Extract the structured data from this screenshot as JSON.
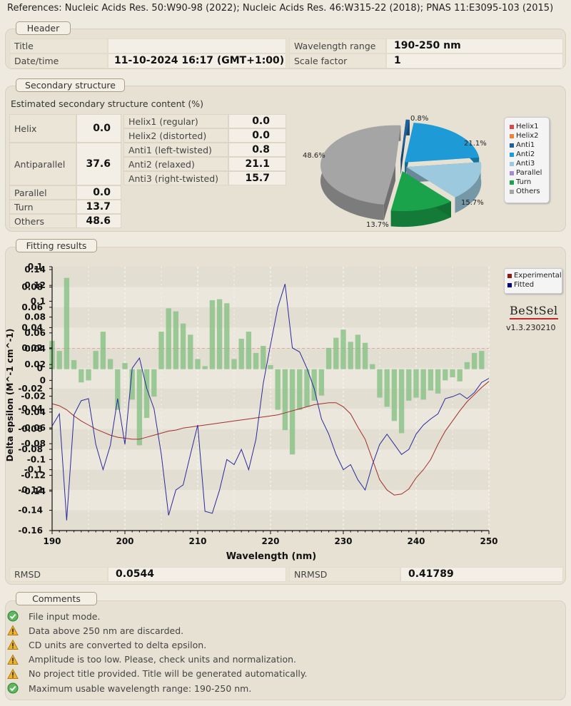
{
  "references": "References: Nucleic Acids Res. 50:W90-98 (2022); Nucleic Acids Res. 46:W315-22 (2018); PNAS 11:E3095-103 (2015)",
  "header": {
    "tab": "Header",
    "title_label": "Title",
    "title_value": "",
    "datetime_label": "Date/time",
    "datetime_value": "11-10-2024 16:17 (GMT+1:00)",
    "wl_label": "Wavelength range",
    "wl_value": "190-250 nm",
    "scale_label": "Scale factor",
    "scale_value": "1"
  },
  "secondary": {
    "tab": "Secondary structure",
    "title": "Estimated secondary structure content (%)",
    "main": [
      {
        "label": "Helix",
        "value": "0.0"
      },
      {
        "label": "Antiparallel",
        "value": "37.6"
      },
      {
        "label": "Parallel",
        "value": "0.0"
      },
      {
        "label": "Turn",
        "value": "13.7"
      },
      {
        "label": "Others",
        "value": "48.6"
      }
    ],
    "sub": [
      {
        "label": "Helix1 (regular)",
        "value": "0.0"
      },
      {
        "label": "Helix2 (distorted)",
        "value": "0.0"
      },
      {
        "label": "Anti1 (left-twisted)",
        "value": "0.8"
      },
      {
        "label": "Anti2 (relaxed)",
        "value": "21.1"
      },
      {
        "label": "Anti3 (right-twisted)",
        "value": "15.7"
      }
    ],
    "pie_legend": [
      {
        "name": "Helix1",
        "color": "#d94a4a"
      },
      {
        "name": "Helix2",
        "color": "#f0803a"
      },
      {
        "name": "Anti1",
        "color": "#1f5f9a"
      },
      {
        "name": "Anti2",
        "color": "#1e9ad6"
      },
      {
        "name": "Anti3",
        "color": "#9cc9dd"
      },
      {
        "name": "Parallel",
        "color": "#a78ad0"
      },
      {
        "name": "Turn",
        "color": "#1aa34a"
      },
      {
        "name": "Others",
        "color": "#a5a5a5"
      }
    ]
  },
  "fitting": {
    "tab": "Fitting results",
    "rmsd_label": "RMSD",
    "rmsd_value": "0.0544",
    "nrmsd_label": "NRMSD",
    "nrmsd_value": "0.41789",
    "logo": "BeStSel",
    "version": "v1.3.230210"
  },
  "comments": {
    "tab": "Comments",
    "items": [
      {
        "text": "File input mode.",
        "icon": "check-icon"
      },
      {
        "text": "Data above 250 nm are discarded.",
        "icon": "warning-icon"
      },
      {
        "text": "CD units are converted to delta epsilon.",
        "icon": "warning-icon"
      },
      {
        "text": "Amplitude is too low. Please, check units and normalization.",
        "icon": "warning-icon"
      },
      {
        "text": "No project title provided. Title will be generated automatically.",
        "icon": "warning-icon"
      },
      {
        "text": "Maximum usable wavelength range: 190-250 nm.",
        "icon": "check-icon"
      }
    ]
  },
  "chart_data": [
    {
      "type": "pie",
      "title": "",
      "slice_labels": [
        "0.8%",
        "21.1%",
        "15.7%",
        "13.7%",
        "48.6%"
      ],
      "slices": [
        {
          "name": "Anti1",
          "value": 0.8,
          "color": "#1f5f9a"
        },
        {
          "name": "Anti2",
          "value": 21.1,
          "color": "#1e9ad6"
        },
        {
          "name": "Anti3",
          "value": 15.7,
          "color": "#9cc9dd"
        },
        {
          "name": "Turn",
          "value": 13.7,
          "color": "#1aa34a"
        },
        {
          "name": "Others",
          "value": 48.6,
          "color": "#a5a5a5"
        }
      ]
    },
    {
      "type": "bar",
      "xlabel": "Wavelength (nm)",
      "ylabel": "Delta epsilon (M^-1 cm^-1)",
      "xlim": [
        190,
        250
      ],
      "ylim": [
        -0.16,
        0.1
      ],
      "x_ticks": [
        190,
        200,
        210,
        220,
        230,
        240,
        250
      ],
      "y_ticks_a": [
        "0.14",
        "0.12",
        "0.1",
        "0.08",
        "0.06",
        "0.04",
        "0.02",
        "0",
        "-0.02",
        "-0.04",
        "-0.06",
        "-0.08",
        "-0.1",
        "-0.12",
        "-0.14"
      ],
      "y_ticks_b": [
        "0.1",
        "0.08",
        "0.06",
        "0.04",
        "0.02",
        "0",
        "-0.02",
        "-0.04",
        "-0.06",
        "-0.08",
        "-0.1",
        "-0.12",
        "-0.14",
        "-0.16"
      ],
      "legend": [
        {
          "name": "Experimental",
          "color": "#8b1a1a"
        },
        {
          "name": "Fitted",
          "color": "#00008b"
        }
      ],
      "residuals": {
        "x": [
          190,
          191,
          192,
          193,
          194,
          195,
          196,
          197,
          198,
          199,
          200,
          201,
          202,
          203,
          204,
          205,
          206,
          207,
          208,
          209,
          210,
          211,
          212,
          213,
          214,
          215,
          216,
          217,
          218,
          219,
          220,
          221,
          222,
          223,
          224,
          225,
          226,
          227,
          228,
          229,
          230,
          231,
          232,
          233,
          234,
          235,
          236,
          237,
          238,
          239,
          240,
          241,
          242,
          243,
          244,
          245,
          246,
          247,
          248,
          249,
          250
        ],
        "values": [
          0.028,
          0.018,
          0.09,
          0.009,
          -0.013,
          -0.011,
          0.018,
          0.037,
          0.01,
          -0.04,
          0.006,
          -0.03,
          -0.075,
          -0.048,
          -0.027,
          0.037,
          0.06,
          0.057,
          0.045,
          0.034,
          0.01,
          0.003,
          0.068,
          0.069,
          0.065,
          0.01,
          0.03,
          0.037,
          0.016,
          0.023,
          0.004,
          -0.04,
          -0.06,
          -0.084,
          -0.04,
          -0.037,
          -0.031,
          -0.026,
          0.021,
          0.031,
          0.039,
          0.027,
          0.034,
          0.026,
          0.005,
          -0.028,
          -0.037,
          -0.051,
          -0.063,
          -0.031,
          -0.028,
          -0.03,
          -0.021,
          -0.024,
          -0.011,
          -0.008,
          -0.012,
          0.007,
          0.016,
          0.018
        ]
      },
      "experimental": {
        "x": [
          190,
          191,
          192,
          193,
          194,
          195,
          196,
          197,
          198,
          199,
          200,
          201,
          202,
          203,
          204,
          205,
          206,
          207,
          208,
          209,
          210,
          211,
          212,
          213,
          214,
          215,
          216,
          217,
          218,
          219,
          220,
          221,
          222,
          223,
          224,
          225,
          226,
          227,
          228,
          229,
          230,
          231,
          232,
          233,
          234,
          235,
          236,
          237,
          238,
          239,
          240,
          241,
          242,
          243,
          244,
          245,
          246,
          247,
          248,
          249,
          250
        ],
        "values": [
          -0.035,
          -0.037,
          -0.041,
          -0.047,
          -0.052,
          -0.056,
          -0.06,
          -0.063,
          -0.066,
          -0.068,
          -0.069,
          -0.07,
          -0.07,
          -0.068,
          -0.066,
          -0.064,
          -0.062,
          -0.061,
          -0.059,
          -0.058,
          -0.057,
          -0.056,
          -0.055,
          -0.054,
          -0.053,
          -0.052,
          -0.051,
          -0.05,
          -0.049,
          -0.048,
          -0.047,
          -0.046,
          -0.044,
          -0.042,
          -0.04,
          -0.038,
          -0.036,
          -0.035,
          -0.034,
          -0.034,
          -0.038,
          -0.045,
          -0.058,
          -0.07,
          -0.09,
          -0.11,
          -0.12,
          -0.125,
          -0.124,
          -0.119,
          -0.108,
          -0.1,
          -0.09,
          -0.075,
          -0.062,
          -0.052,
          -0.042,
          -0.033,
          -0.026,
          -0.019,
          -0.013
        ]
      },
      "fitted": {
        "x": [
          190,
          191,
          192,
          193,
          194,
          195,
          196,
          197,
          198,
          199,
          200,
          201,
          202,
          203,
          204,
          205,
          206,
          207,
          208,
          209,
          210,
          211,
          212,
          213,
          214,
          215,
          216,
          217,
          218,
          219,
          220,
          221,
          222,
          223,
          224,
          225,
          226,
          227,
          228,
          229,
          230,
          231,
          232,
          233,
          234,
          235,
          236,
          237,
          238,
          239,
          240,
          241,
          242,
          243,
          244,
          245,
          246,
          247,
          248,
          249,
          250
        ],
        "values": [
          -0.057,
          -0.045,
          -0.15,
          -0.046,
          -0.032,
          -0.03,
          -0.075,
          -0.1,
          -0.076,
          -0.03,
          -0.075,
          -0.0,
          0.01,
          -0.02,
          -0.04,
          -0.085,
          -0.145,
          -0.12,
          -0.115,
          -0.085,
          -0.056,
          -0.141,
          -0.143,
          -0.12,
          -0.09,
          -0.095,
          -0.08,
          -0.1,
          -0.07,
          -0.015,
          0.023,
          0.06,
          0.083,
          0.02,
          0.016,
          0.0,
          -0.02,
          -0.05,
          -0.065,
          -0.085,
          -0.1,
          -0.095,
          -0.11,
          -0.12,
          -0.095,
          -0.075,
          -0.065,
          -0.075,
          -0.085,
          -0.08,
          -0.065,
          -0.056,
          -0.05,
          -0.045,
          -0.03,
          -0.028,
          -0.025,
          -0.03,
          -0.024,
          -0.014,
          -0.01
        ]
      }
    }
  ]
}
